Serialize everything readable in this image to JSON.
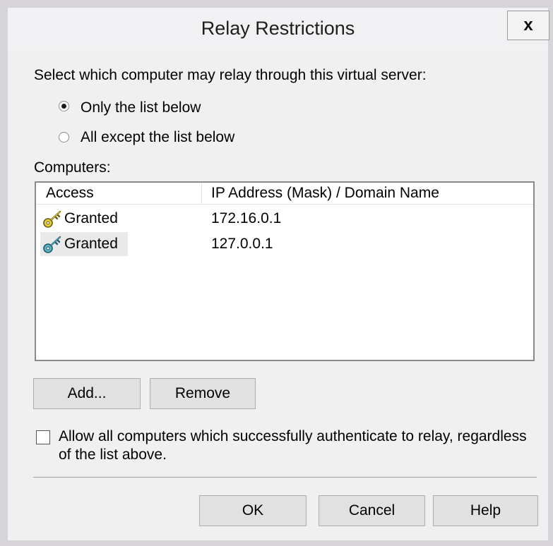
{
  "dialog": {
    "title": "Relay Restrictions",
    "close_label": "x"
  },
  "select_prompt": "Select which computer may relay through this virtual server:",
  "radio_options": [
    {
      "label": "Only the list below",
      "checked": true
    },
    {
      "label": "All except the list below",
      "checked": false
    }
  ],
  "computers_label": "Computers:",
  "list": {
    "columns": [
      "Access",
      "IP Address (Mask) / Domain Name"
    ],
    "rows": [
      {
        "access": "Granted",
        "ip": "172.16.0.1",
        "icon": "key-icon",
        "icon_color": "#e8d23a"
      },
      {
        "access": "Granted",
        "ip": "127.0.0.1",
        "icon": "key-icon",
        "icon_color": "#5fb3c8"
      }
    ]
  },
  "buttons": {
    "add": "Add...",
    "remove": "Remove",
    "ok": "OK",
    "cancel": "Cancel",
    "help": "Help"
  },
  "allow_auth": {
    "label_line1": "Allow all computers which successfully authenticate to relay, regardless",
    "label_line2": "of the list above.",
    "checked": false
  }
}
